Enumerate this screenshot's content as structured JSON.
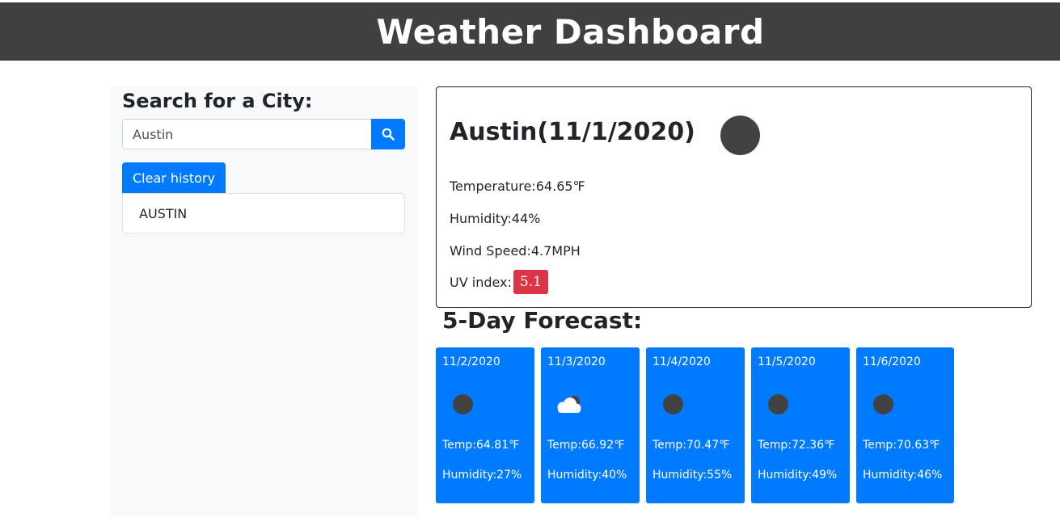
{
  "header": {
    "title": "Weather Dashboard"
  },
  "sidebar": {
    "heading": "Search for a City:",
    "search": {
      "value": "Austin",
      "icon": "search-icon"
    },
    "clear_label": "Clear history",
    "history": [
      "AUSTIN"
    ]
  },
  "current": {
    "title": "Austin(11/1/2020)",
    "icon": "weather-dot-icon",
    "temperature": "Temperature:64.65℉",
    "humidity": "Humidity:44%",
    "wind": "Wind Speed:4.7MPH",
    "uv_label": "UV index:",
    "uv_value": "5.1",
    "uv_color": "#dc3545"
  },
  "forecast": {
    "title": "5-Day Forecast:",
    "card_color": "#007bff",
    "days": [
      {
        "date": "11/2/2020",
        "icon": "weather-dot-icon",
        "temp": "Temp:64.81℉",
        "humidity": "Humidity:27%"
      },
      {
        "date": "11/3/2020",
        "icon": "cloud-icon",
        "temp": "Temp:66.92℉",
        "humidity": "Humidity:40%"
      },
      {
        "date": "11/4/2020",
        "icon": "weather-dot-icon",
        "temp": "Temp:70.47℉",
        "humidity": "Humidity:55%"
      },
      {
        "date": "11/5/2020",
        "icon": "weather-dot-icon",
        "temp": "Temp:72.36℉",
        "humidity": "Humidity:49%"
      },
      {
        "date": "11/6/2020",
        "icon": "weather-dot-icon",
        "temp": "Temp:70.63℉",
        "humidity": "Humidity:46%"
      }
    ]
  }
}
